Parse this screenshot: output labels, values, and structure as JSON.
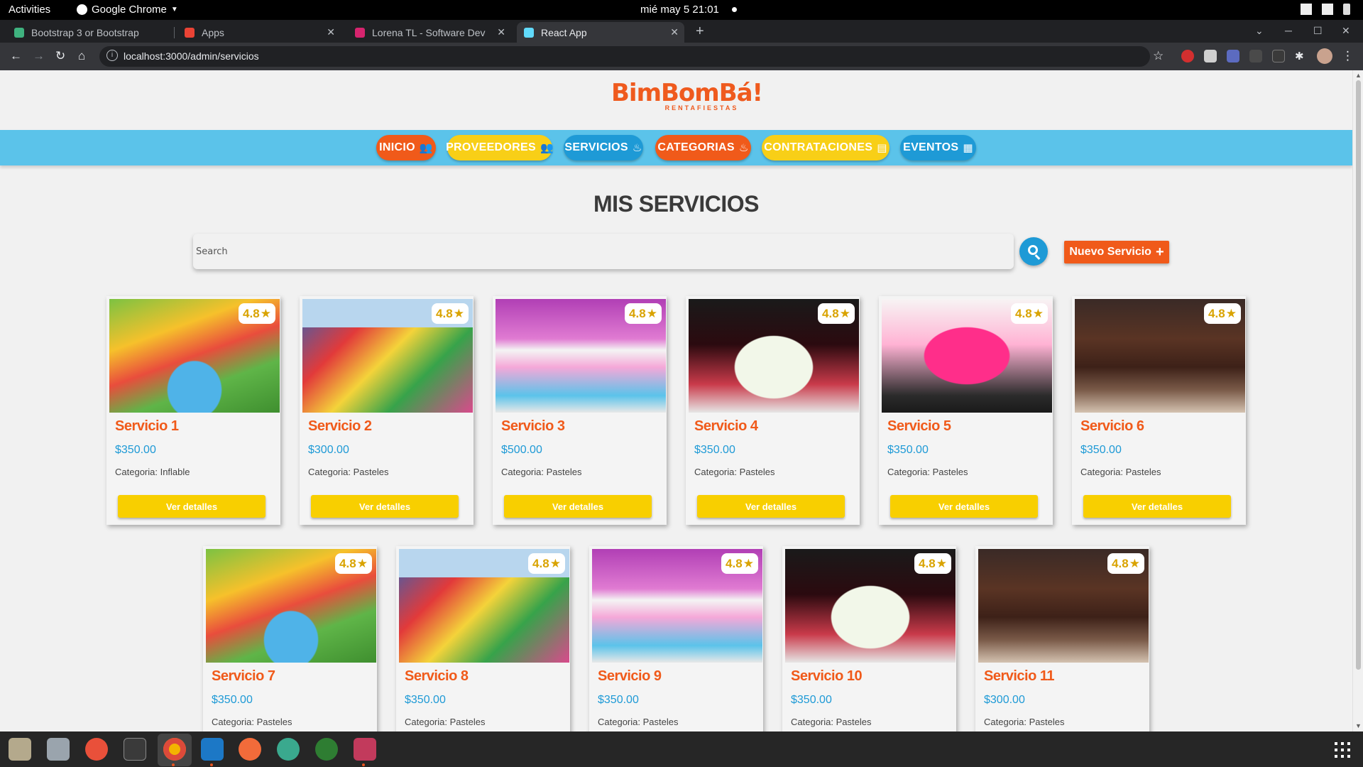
{
  "desktop": {
    "activities": "Activities",
    "app_name": "Google Chrome",
    "clock": "mié may 5  21:01"
  },
  "browser": {
    "tabs": [
      {
        "title": "Bootstrap 3 or Bootstrap",
        "favicon_color": "#3fb27f"
      },
      {
        "title": "Apps",
        "favicon_color": "#ea4335"
      },
      {
        "title": "Lorena TL - Software Dev",
        "favicon_color": "#d6246e"
      },
      {
        "title": "React App",
        "favicon_color": "#61dafb"
      }
    ],
    "url": "localhost:3000/admin/servicios"
  },
  "site": {
    "logo": "BimBomBá!",
    "tagline": "RENTAFIESTAS",
    "nav": [
      {
        "label": "INICIO",
        "icon": "users-icon",
        "color": "orange"
      },
      {
        "label": "PROVEEDORES",
        "icon": "users-icon",
        "color": "yellow"
      },
      {
        "label": "SERVICIOS",
        "icon": "cake-icon",
        "color": "blue"
      },
      {
        "label": "CATEGORIAS",
        "icon": "cake-icon",
        "color": "orange"
      },
      {
        "label": "CONTRATACIONES",
        "icon": "id-card-icon",
        "color": "yellow"
      },
      {
        "label": "EVENTOS",
        "icon": "calendar-icon",
        "color": "blue"
      }
    ],
    "page_title": "MIS SERVICIOS",
    "search_placeholder": "Search",
    "new_button": "Nuevo Servicio",
    "details_button": "Ver detalles",
    "colors": {
      "orange": "#f05a1a",
      "yellow": "#f8cf17",
      "blue": "#1e9ad6",
      "band": "#5bc3ea"
    }
  },
  "services": [
    {
      "name": "Servicio 1",
      "price": "$350.00",
      "category": "Categoria: Inflable",
      "rating": "4.8",
      "image": "inflatable-pool"
    },
    {
      "name": "Servicio 2",
      "price": "$300.00",
      "category": "Categoria: Pasteles",
      "rating": "4.8",
      "image": "inflatable-slide"
    },
    {
      "name": "Servicio 3",
      "price": "$500.00",
      "category": "Categoria: Pasteles",
      "rating": "4.8",
      "image": "bounce-house"
    },
    {
      "name": "Servicio 4",
      "price": "$350.00",
      "category": "Categoria: Pasteles",
      "rating": "4.8",
      "image": "drip-cake-white"
    },
    {
      "name": "Servicio 5",
      "price": "$350.00",
      "category": "Categoria: Pasteles",
      "rating": "4.8",
      "image": "drip-cake-pink"
    },
    {
      "name": "Servicio 6",
      "price": "$350.00",
      "category": "Categoria: Pasteles",
      "rating": "4.8",
      "image": "chocolate-cake"
    },
    {
      "name": "Servicio 7",
      "price": "$350.00",
      "category": "Categoria: Pasteles",
      "rating": "4.8",
      "image": "inflatable-pool"
    },
    {
      "name": "Servicio 8",
      "price": "$350.00",
      "category": "Categoria: Pasteles",
      "rating": "4.8",
      "image": "inflatable-slide"
    },
    {
      "name": "Servicio 9",
      "price": "$350.00",
      "category": "Categoria: Pasteles",
      "rating": "4.8",
      "image": "bounce-house"
    },
    {
      "name": "Servicio 10",
      "price": "$350.00",
      "category": "Categoria: Pasteles",
      "rating": "4.8",
      "image": "drip-cake-white"
    },
    {
      "name": "Servicio 11",
      "price": "$300.00",
      "category": "Categoria: Pasteles",
      "rating": "4.8",
      "image": "chocolate-cake"
    }
  ]
}
